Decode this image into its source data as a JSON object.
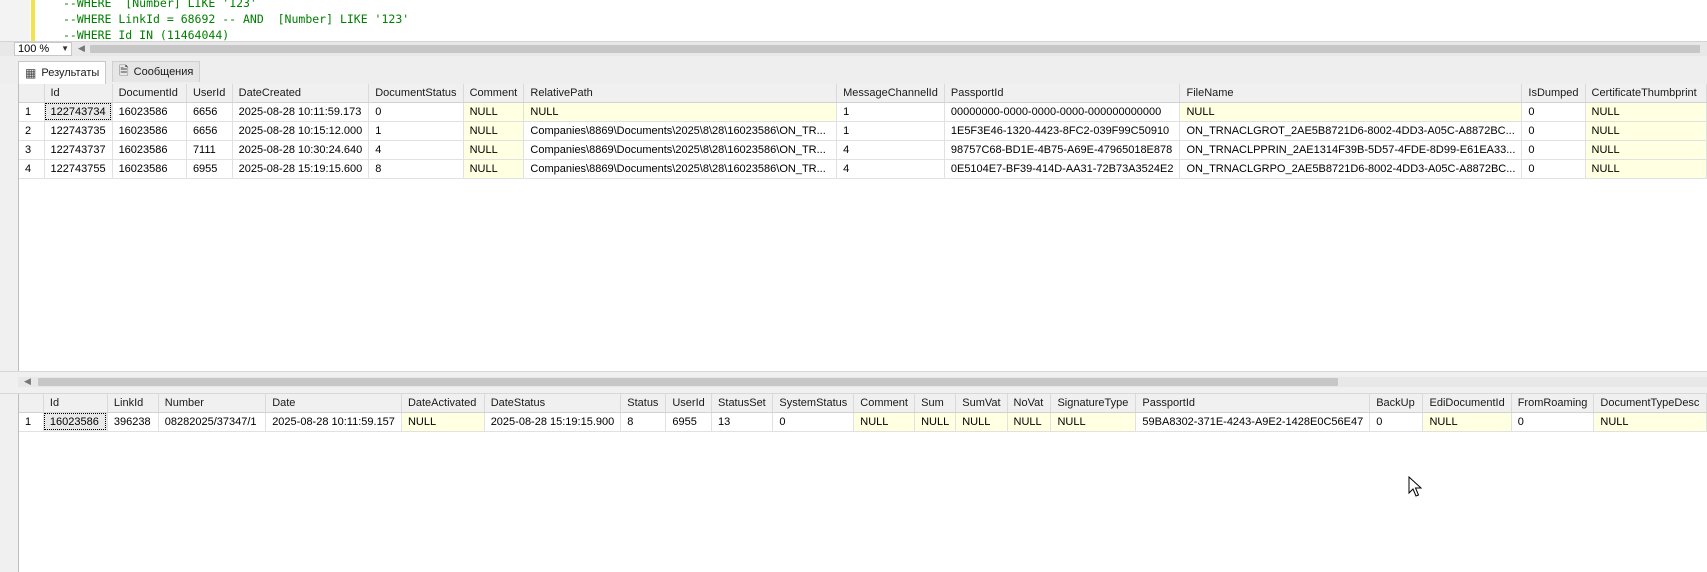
{
  "editor": {
    "lines": [
      "--WHERE  [Number] LIKE '123'",
      "--WHERE LinkId = 68692 -- AND  [Number] LIKE '123'",
      "--WHERE Id IN (11464044)"
    ]
  },
  "zoom": {
    "value": "100 %"
  },
  "tabs": {
    "results_label": "Результаты",
    "messages_label": "Сообщения"
  },
  "grid1": {
    "columns": [
      "Id",
      "DocumentId",
      "UserId",
      "DateCreated",
      "DocumentStatus",
      "Comment",
      "RelativePath",
      "MessageChannelId",
      "PassportId",
      "FileName",
      "IsDumped",
      "CertificateThumbprint"
    ],
    "rows": [
      [
        "1",
        "122743734",
        "16023586",
        "6656",
        "2025-08-28 10:11:59.173",
        "0",
        "NULL",
        "NULL",
        "1",
        "00000000-0000-0000-0000-000000000000",
        "NULL",
        "0",
        "NULL"
      ],
      [
        "2",
        "122743735",
        "16023586",
        "6656",
        "2025-08-28 10:15:12.000",
        "1",
        "NULL",
        "Companies\\8869\\Documents\\2025\\8\\28\\16023586\\ON_TR...",
        "1",
        "1E5F3E46-1320-4423-8FC2-039F99C50910",
        "ON_TRNACLGROT_2AE5B8721D6-8002-4DD3-A05C-A8872BC...",
        "0",
        "NULL"
      ],
      [
        "3",
        "122743737",
        "16023586",
        "7111",
        "2025-08-28 10:30:24.640",
        "4",
        "NULL",
        "Companies\\8869\\Documents\\2025\\8\\28\\16023586\\ON_TR...",
        "4",
        "98757C68-BD1E-4B75-A69E-47965018E878",
        "ON_TRNACLPPRIN_2AE1314F39B-5D57-4FDE-8D99-E61EA33...",
        "0",
        "NULL"
      ],
      [
        "4",
        "122743755",
        "16023586",
        "6955",
        "2025-08-28 15:19:15.600",
        "8",
        "NULL",
        "Companies\\8869\\Documents\\2025\\8\\28\\16023586\\ON_TR...",
        "4",
        "0E5104E7-BF39-414D-AA31-72B73A3524E2",
        "ON_TRNACLGRPO_2AE5B8721D6-8002-4DD3-A05C-A8872BC...",
        "0",
        "NULL"
      ]
    ]
  },
  "grid2": {
    "columns": [
      "Id",
      "LinkId",
      "Number",
      "Date",
      "DateActivated",
      "DateStatus",
      "Status",
      "UserId",
      "StatusSet",
      "SystemStatus",
      "Comment",
      "Sum",
      "SumVat",
      "NoVat",
      "SignatureType",
      "PassportId",
      "BackUp",
      "EdiDocumentId",
      "FromRoaming",
      "DocumentTypeDesc"
    ],
    "rows": [
      [
        "1",
        "16023586",
        "396238",
        "08282025/37347/1",
        "2025-08-28 10:11:59.157",
        "NULL",
        "2025-08-28 15:19:15.900",
        "8",
        "6955",
        "13",
        "0",
        "NULL",
        "NULL",
        "NULL",
        "NULL",
        "NULL",
        "59BA8302-371E-4243-A9E2-1428E0C56E47",
        "0",
        "NULL",
        "0",
        "NULL"
      ]
    ]
  },
  "colors": {
    "null_cell": "#ffffe1",
    "comment_green": "#008000",
    "marker_yellow": "#f2e34a"
  }
}
